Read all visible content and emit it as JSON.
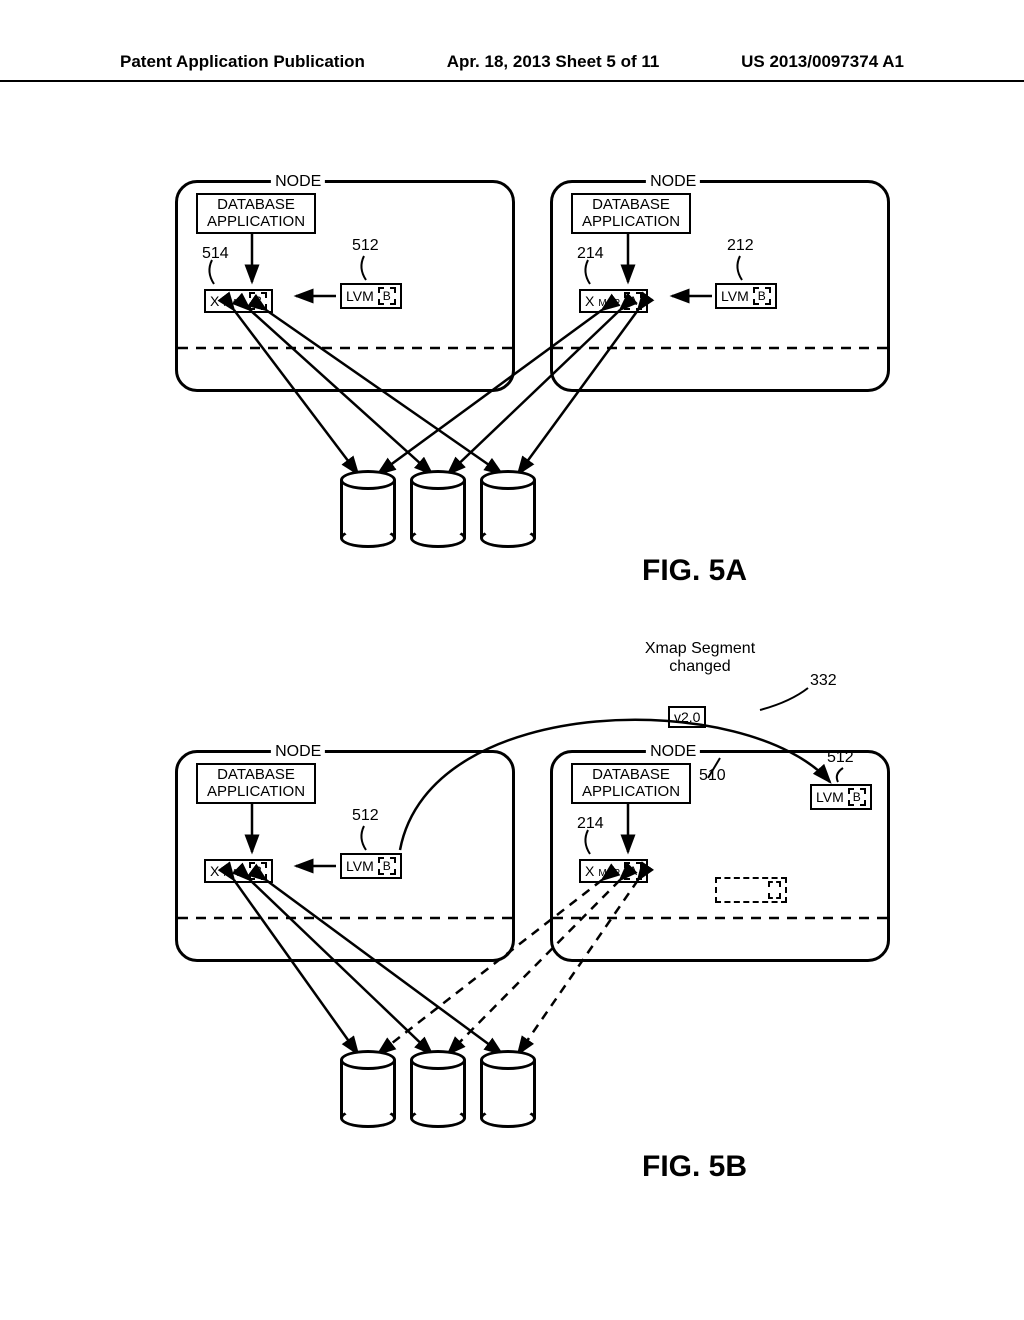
{
  "header": {
    "left": "Patent Application Publication",
    "center": "Apr. 18, 2013  Sheet 5 of 11",
    "right": "US 2013/0097374 A1"
  },
  "figA": {
    "label": "FIG. 5A",
    "nodeL": {
      "title": "NODE",
      "db": "DATABASE\nAPPLICATION",
      "ref_xmap": "514",
      "ref_lvm": "512",
      "xmap": "X",
      "xmap_sub": "MAP",
      "xmap_ver": "B",
      "lvm": "LVM",
      "lvm_ver": "B"
    },
    "nodeR": {
      "title": "NODE",
      "db": "DATABASE\nAPPLICATION",
      "ref_xmap": "214",
      "ref_lvm": "212",
      "xmap": "X",
      "xmap_sub": "MAP",
      "xmap_ver": "A",
      "lvm": "LVM",
      "lvm_ver": "B"
    }
  },
  "figB": {
    "label": "FIG. 5B",
    "anno": "Xmap Segment\nchanged",
    "ver_msg": "v2.0",
    "ref_332": "332",
    "nodeL": {
      "title": "NODE",
      "db": "DATABASE\nAPPLICATION",
      "ref_lvm": "512",
      "xmap": "X",
      "xmap_sub": "MAP",
      "xmap_ver": "B",
      "lvm": "LVM",
      "lvm_ver": "B"
    },
    "nodeR": {
      "title": "NODE",
      "db": "DATABASE\nAPPLICATION",
      "ref_xmap": "214",
      "ref_510": "510",
      "ref_512": "512",
      "xmap": "X",
      "xmap_sub": "MAP",
      "xmap_ver": "A",
      "lvm": "LVM",
      "lvm_ver": "B"
    }
  }
}
